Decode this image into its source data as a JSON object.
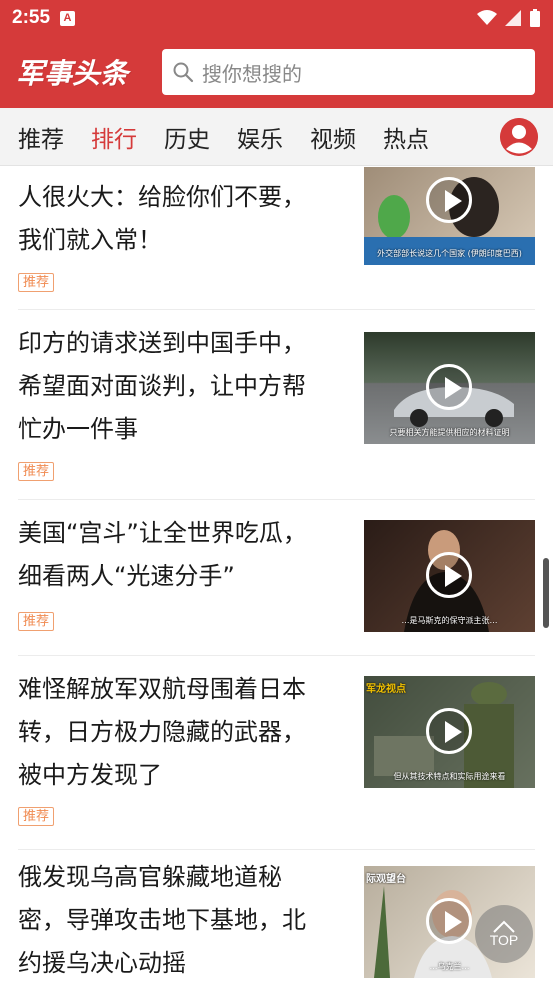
{
  "status": {
    "time": "2:55",
    "notif_badge": "A"
  },
  "header": {
    "logo": "军事头条",
    "search_placeholder": "搜你想搜的"
  },
  "tabs": [
    {
      "label": "推荐",
      "active": false
    },
    {
      "label": "排行",
      "active": true
    },
    {
      "label": "历史",
      "active": false
    },
    {
      "label": "娱乐",
      "active": false
    },
    {
      "label": "视频",
      "active": false
    },
    {
      "label": "热点",
      "active": false
    }
  ],
  "articles": [
    {
      "line1": "人很火大：给脸你们不要，",
      "line2": "我们就入常！",
      "line3": "",
      "tag": "推荐",
      "thumb": {
        "caption": "外交部部长说这几个国家 (伊朗印度巴西)",
        "corner": "",
        "colors": [
          "#8a7a6a",
          "#c8b7a5"
        ]
      }
    },
    {
      "line1": "印方的请求送到中国手中，",
      "line2": "希望面对面谈判，让中方帮",
      "line3": "忙办一件事",
      "tag": "推荐",
      "thumb": {
        "caption": "只要相关方能提供相应的材料证明",
        "corner": "",
        "colors": [
          "#4e5052",
          "#8a8d8f"
        ]
      }
    },
    {
      "line1": "美国“宫斗”让全世界吃瓜，",
      "line2": "细看两人“光速分手”",
      "line3": "",
      "tag": "推荐",
      "thumb": {
        "caption": "…是马斯克的保守派主张…",
        "corner": "",
        "colors": [
          "#3b2a24",
          "#6a4e3e"
        ]
      }
    },
    {
      "line1": "难怪解放军双航母围着日本",
      "line2": "转，日方极力隐藏的武器，",
      "line3": "被中方发现了",
      "tag": "推荐",
      "thumb": {
        "caption": "但从其技术特点和实际用途来看",
        "corner": "军龙视点",
        "colors": [
          "#3f4a3a",
          "#77806a"
        ]
      }
    },
    {
      "line1": "俄发现乌高官躲藏地道秘",
      "line2": "密，导弹攻击地下基地，北",
      "line3": "约援乌决心动摇",
      "tag": "",
      "thumb": {
        "caption": "…乌克兰…",
        "corner": "际观望台",
        "colors": [
          "#bfb6a6",
          "#e6ded2"
        ]
      }
    }
  ],
  "top_button": {
    "label": "TOP"
  }
}
